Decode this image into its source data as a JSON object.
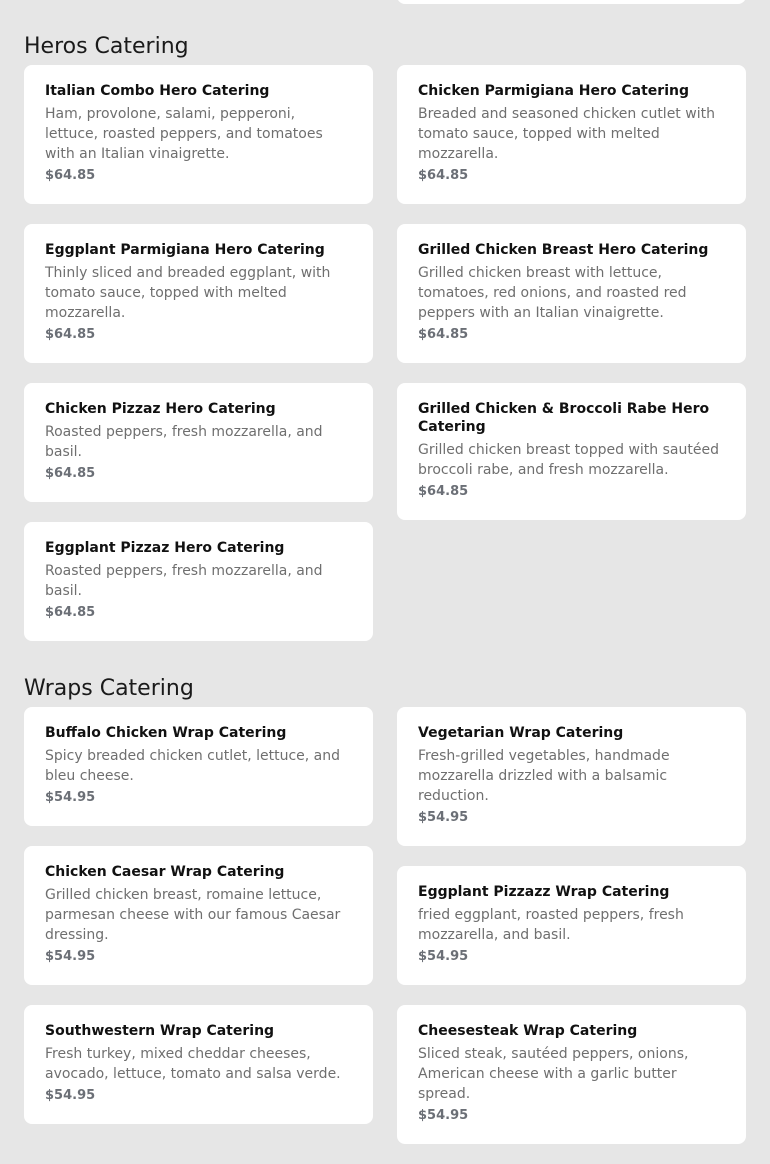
{
  "sections": [
    {
      "title": "Heros Catering",
      "items": [
        {
          "name": "Italian Combo Hero Catering",
          "description": "Ham, provolone, salami, pepperoni, lettuce, roasted peppers, and tomatoes with an Italian vinaigrette.",
          "price": "$64.85"
        },
        {
          "name": "Chicken Parmigiana Hero Catering",
          "description": "Breaded and seasoned chicken cutlet with tomato sauce, topped with melted mozzarella.",
          "price": "$64.85"
        },
        {
          "name": "Eggplant Parmigiana Hero Catering",
          "description": "Thinly sliced and breaded eggplant, with tomato sauce, topped with melted mozzarella.",
          "price": "$64.85"
        },
        {
          "name": "Grilled Chicken Breast Hero Catering",
          "description": "Grilled chicken breast with lettuce, tomatoes, red onions, and roasted red peppers with an Italian vinaigrette.",
          "price": "$64.85"
        },
        {
          "name": "Chicken Pizzaz Hero Catering",
          "description": "Roasted peppers, fresh mozzarella, and basil.",
          "price": "$64.85"
        },
        {
          "name": "Grilled Chicken & Broccoli Rabe Hero Catering",
          "description": "Grilled chicken breast topped with sautéed broccoli rabe, and fresh mozzarella.",
          "price": "$64.85"
        },
        {
          "name": "Eggplant Pizzaz Hero Catering",
          "description": "Roasted peppers, fresh mozzarella, and basil.",
          "price": "$64.85"
        }
      ]
    },
    {
      "title": "Wraps Catering",
      "items": [
        {
          "name": "Buffalo Chicken Wrap Catering",
          "description": "Spicy breaded chicken cutlet, lettuce, and bleu cheese.",
          "price": "$54.95"
        },
        {
          "name": "Vegetarian Wrap Catering",
          "description": "Fresh-grilled vegetables, handmade mozzarella drizzled with a balsamic reduction.",
          "price": "$54.95"
        },
        {
          "name": "Chicken Caesar Wrap Catering",
          "description": "Grilled chicken breast, romaine lettuce, parmesan cheese with our famous Caesar dressing.",
          "price": "$54.95"
        },
        {
          "name": "Eggplant Pizzazz Wrap Catering",
          "description": "fried eggplant, roasted peppers, fresh mozzarella, and basil.",
          "price": "$54.95"
        },
        {
          "name": "Southwestern Wrap Catering",
          "description": "Fresh turkey, mixed cheddar cheeses, avocado, lettuce, tomato and salsa verde.",
          "price": "$54.95"
        },
        {
          "name": "Cheesesteak Wrap Catering",
          "description": "Sliced steak, sautéed peppers, onions, American cheese with a garlic butter spread.",
          "price": "$54.95"
        }
      ]
    }
  ]
}
